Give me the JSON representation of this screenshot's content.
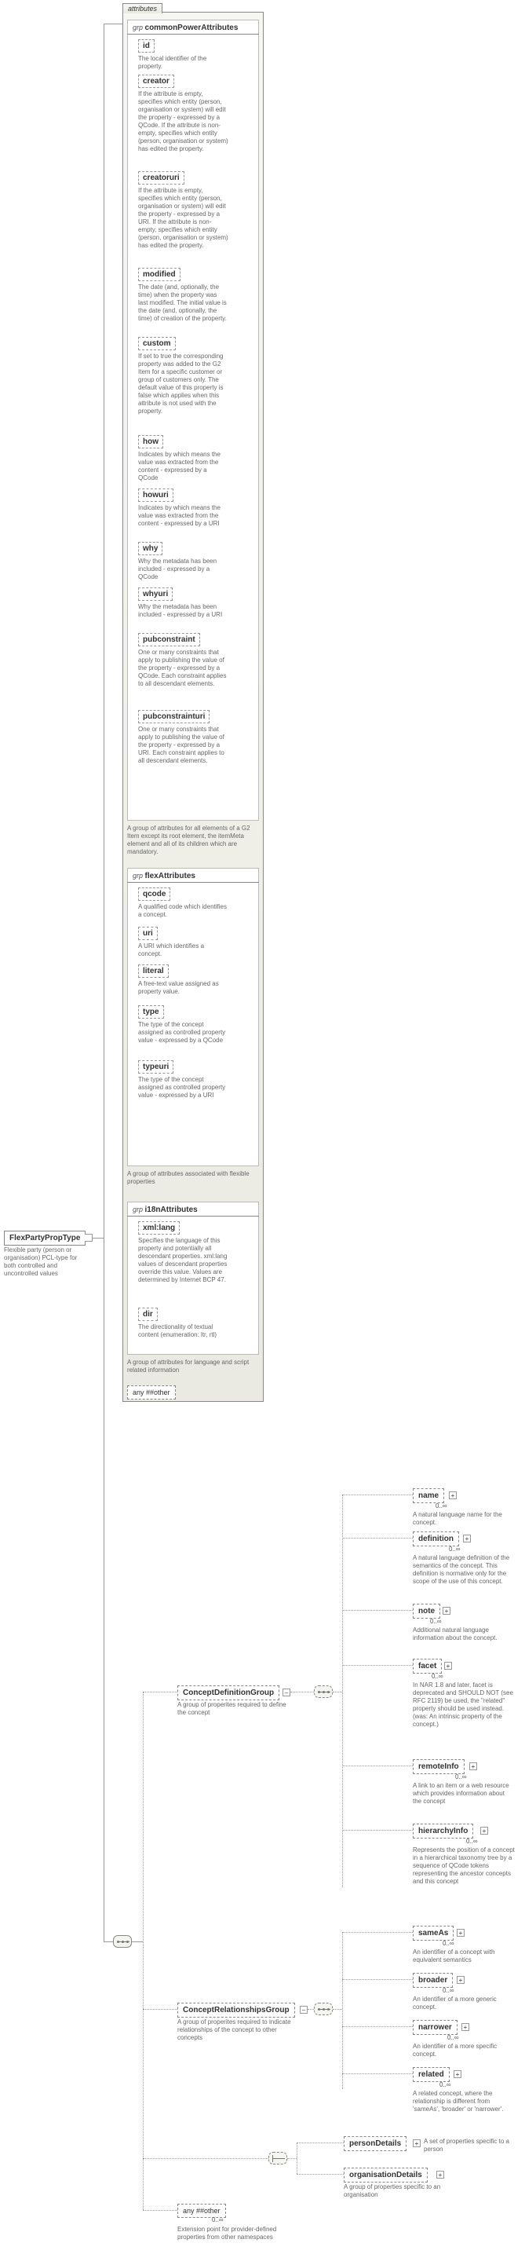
{
  "root": {
    "name": "FlexPartyPropType",
    "desc": "Flexible party (person or organisation) PCL-type for both controlled and uncontrolled values"
  },
  "panels": {
    "attributes_tab": "attributes",
    "common": {
      "header_prefix": "grp ",
      "header_name": "commonPowerAttributes",
      "footer": "A group of attributes for all elements of a G2 Item except its root element, the itemMeta element and all of its children which are mandatory.",
      "attrs": [
        {
          "name": "id",
          "desc": "The local identifier of the property."
        },
        {
          "name": "creator",
          "desc": "If the attribute is empty, specifies which entity (person, organisation or system) will edit the property - expressed by a QCode. If the attribute is non-empty, specifies which entity (person, organisation or system) has edited the property."
        },
        {
          "name": "creatoruri",
          "desc": "If the attribute is empty, specifies which entity (person, organisation or system) will edit the property - expressed by a URI. If the attribute is non-empty, specifies which entity (person, organisation or system) has edited the property."
        },
        {
          "name": "modified",
          "desc": "The date (and, optionally, the time) when the property was last modified. The initial value is the date (and, optionally, the time) of creation of the property."
        },
        {
          "name": "custom",
          "desc": "If set to true the corresponding property was added to the G2 Item for a specific customer or group of customers only. The default value of this property is false which applies when this attribute is not used with the property."
        },
        {
          "name": "how",
          "desc": "Indicates by which means the value was extracted from the content - expressed by a QCode"
        },
        {
          "name": "howuri",
          "desc": "Indicates by which means the value was extracted from the content - expressed by a URI"
        },
        {
          "name": "why",
          "desc": "Why the metadata has been included - expressed by a QCode"
        },
        {
          "name": "whyuri",
          "desc": "Why the metadata has been included - expressed by a URI"
        },
        {
          "name": "pubconstraint",
          "desc": "One or many constraints that apply to publishing the value of the property - expressed by a QCode. Each constraint applies to all descendant elements."
        },
        {
          "name": "pubconstrainturi",
          "desc": "One or many constraints that apply to publishing the value of the property - expressed by a URI. Each constraint applies to all descendant elements."
        }
      ]
    },
    "flex": {
      "header_prefix": "grp ",
      "header_name": "flexAttributes",
      "footer": "A group of attributes associated with flexible properties",
      "attrs": [
        {
          "name": "qcode",
          "desc": "A qualified code which identifies a concept."
        },
        {
          "name": "uri",
          "desc": "A URI which identifies a concept."
        },
        {
          "name": "literal",
          "desc": "A free-text value assigned as property value."
        },
        {
          "name": "type",
          "desc": "The type of the concept assigned as controlled property value - expressed by a QCode"
        },
        {
          "name": "typeuri",
          "desc": "The type of the concept assigned as controlled property value - expressed by a URI"
        }
      ]
    },
    "i18n": {
      "header_prefix": "grp ",
      "header_name": "i18nAttributes",
      "footer": "A group of attributes for language and script related information",
      "attrs": [
        {
          "name": "xml:lang",
          "desc": "Specifies the language of this property and potentially all descendant properties. xml:lang values of descendant properties override this value. Values are determined by Internet BCP 47."
        },
        {
          "name": "dir",
          "desc": "The directionality of textual content (enumeration: ltr, rtl)"
        }
      ]
    },
    "any_other": "any ##other"
  },
  "conceptDef": {
    "name": "ConceptDefinitionGroup",
    "desc": "A group of properites required to define the concept",
    "children": [
      {
        "name": "name",
        "desc": "A natural language name for the concept."
      },
      {
        "name": "definition",
        "desc": "A natural language definition of the semantics of the concept. This definition is normative only for the scope of the use of this concept."
      },
      {
        "name": "note",
        "desc": "Additional natural language information about the concept."
      },
      {
        "name": "facet",
        "desc": "In NAR 1.8 and later, facet is deprecated and SHOULD NOT (see RFC 2119) be used, the \"related\" property should be used instead. (was: An intrinsic property of the concept.)"
      },
      {
        "name": "remoteInfo",
        "desc": "A link to an item or a web resource which provides information about the concept"
      },
      {
        "name": "hierarchyInfo",
        "desc": "Represents the position of a concept in a hierarchical taxonomy tree by a sequence of QCode tokens representing the ancestor concepts and this concept"
      }
    ]
  },
  "conceptRel": {
    "name": "ConceptRelationshipsGroup",
    "desc": "A group of properites required to indicate relationships of the concept to other concepts",
    "children": [
      {
        "name": "sameAs",
        "desc": "An identifier of a concept with equivalent semantics"
      },
      {
        "name": "broader",
        "desc": "An identifier of a more generic concept."
      },
      {
        "name": "narrower",
        "desc": "An identifier of a more specific concept."
      },
      {
        "name": "related",
        "desc": "A related concept, where the relationship is different from 'sameAs', 'broader' or 'narrower'."
      }
    ]
  },
  "personDetails": {
    "name": "personDetails",
    "desc": "A set of properties specific to a person"
  },
  "organisationDetails": {
    "name": "organisationDetails",
    "desc": "A group of properties specific to an organisation"
  },
  "bottomAny": {
    "label": "any ##other",
    "mult": "0..∞",
    "desc": "Extension point for provider-defined properties from other namespaces"
  },
  "mult_inf": "0..∞"
}
